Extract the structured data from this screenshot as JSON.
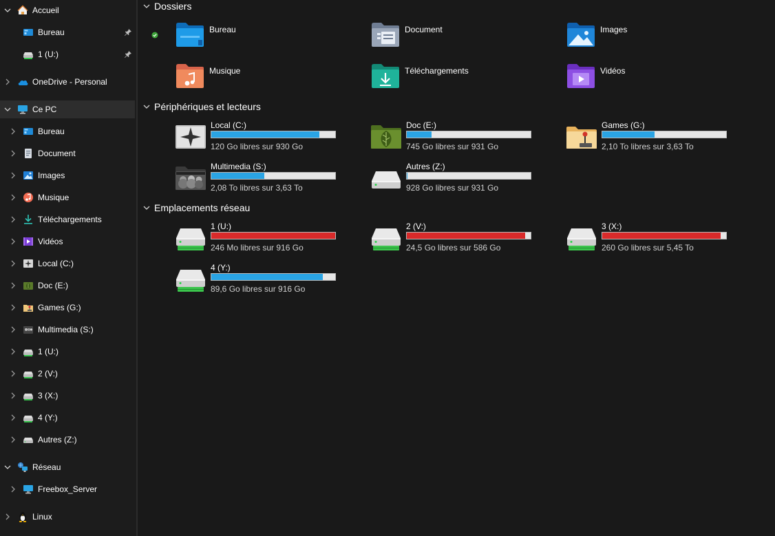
{
  "colors": {
    "normal": "#2aa4e4",
    "full": "#d92a2a"
  },
  "sidebar": {
    "quick": {
      "home_label": "Accueil",
      "items": [
        {
          "label": "Bureau",
          "icon": "desktop-icon"
        },
        {
          "label": "1 (U:)",
          "icon": "network-drive-icon"
        }
      ]
    },
    "onedrive_label": "OneDrive - Personal",
    "thispc": {
      "label": "Ce PC",
      "items": [
        {
          "label": "Bureau",
          "icon": "desktop-icon"
        },
        {
          "label": "Document",
          "icon": "document-icon"
        },
        {
          "label": "Images",
          "icon": "images-icon"
        },
        {
          "label": "Musique",
          "icon": "music-icon"
        },
        {
          "label": "Téléchargements",
          "icon": "download-icon"
        },
        {
          "label": "Vidéos",
          "icon": "video-icon"
        },
        {
          "label": "Local (C:)",
          "icon": "local-drive-icon"
        },
        {
          "label": "Doc (E:)",
          "icon": "doc-drive-icon"
        },
        {
          "label": "Games (G:)",
          "icon": "games-drive-icon"
        },
        {
          "label": "Multimedia (S:)",
          "icon": "multimedia-drive-icon"
        },
        {
          "label": "1 (U:)",
          "icon": "network-drive-icon"
        },
        {
          "label": "2 (V:)",
          "icon": "network-drive-icon"
        },
        {
          "label": "3 (X:)",
          "icon": "network-drive-icon"
        },
        {
          "label": "4 (Y:)",
          "icon": "network-drive-icon"
        },
        {
          "label": "Autres (Z:)",
          "icon": "drive-icon"
        }
      ]
    },
    "network": {
      "label": "Réseau",
      "items": [
        {
          "label": "Freebox_Server",
          "icon": "computer-icon"
        }
      ]
    },
    "linux_label": "Linux"
  },
  "main": {
    "folders": {
      "title": "Dossiers",
      "items": [
        {
          "label": "Bureau",
          "icon": "desktop-folder-icon"
        },
        {
          "label": "Document",
          "icon": "document-folder-icon"
        },
        {
          "label": "Images",
          "icon": "images-folder-icon"
        },
        {
          "label": "Musique",
          "icon": "music-folder-icon"
        },
        {
          "label": "Téléchargements",
          "icon": "download-folder-icon"
        },
        {
          "label": "Vidéos",
          "icon": "video-folder-icon"
        }
      ]
    },
    "devices": {
      "title": "Périphériques et lecteurs",
      "items": [
        {
          "name": "Local (C:)",
          "space": "120 Go libres sur 930 Go",
          "used": 0.871,
          "icon": "local-drive-icon"
        },
        {
          "name": "Doc (E:)",
          "space": "745 Go libres sur 931 Go",
          "used": 0.2,
          "icon": "doc-drive-icon"
        },
        {
          "name": "Games (G:)",
          "space": "2,10 To libres sur 3,63 To",
          "used": 0.421,
          "icon": "games-drive-icon"
        },
        {
          "name": "Multimedia (S:)",
          "space": "2,08 To libres sur 3,63 To",
          "used": 0.427,
          "icon": "multimedia-drive-icon"
        },
        {
          "name": "Autres (Z:)",
          "space": "928 Go libres sur 931 Go",
          "used": 0.003,
          "icon": "drive-icon"
        }
      ]
    },
    "network": {
      "title": "Emplacements réseau",
      "items": [
        {
          "name": "1 (U:)",
          "space": "246 Mo libres sur 916 Go",
          "used": 0.9997,
          "icon": "network-drive-icon"
        },
        {
          "name": "2 (V:)",
          "space": "24,5 Go libres sur 586 Go",
          "used": 0.958,
          "icon": "network-drive-icon"
        },
        {
          "name": "3 (X:)",
          "space": "260 Go libres sur 5,45 To",
          "used": 0.953,
          "icon": "network-drive-icon"
        },
        {
          "name": "4 (Y:)",
          "space": "89,6 Go libres sur 916 Go",
          "used": 0.902,
          "icon": "network-drive-icon"
        }
      ]
    }
  }
}
